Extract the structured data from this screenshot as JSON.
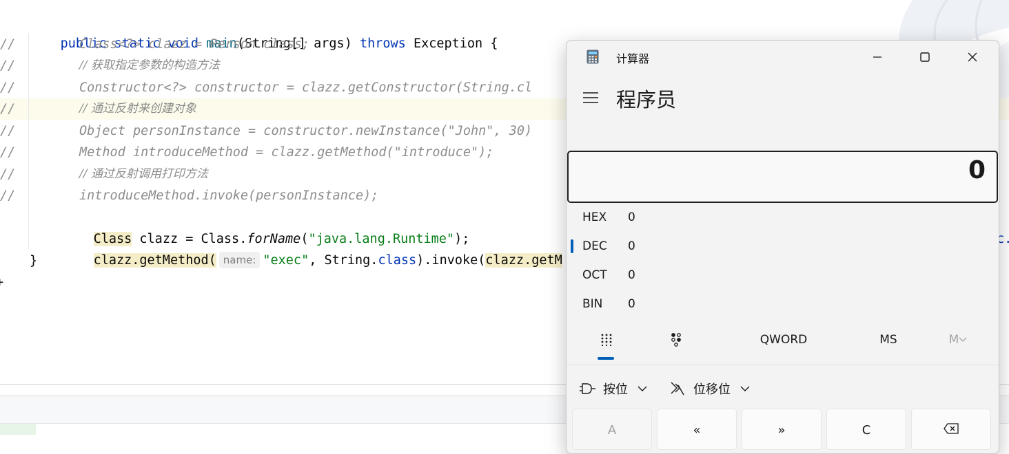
{
  "editor": {
    "lines": {
      "l1": {
        "kw_public": "public",
        "kw_static": "static",
        "kw_void": "void",
        "fn_main": "main",
        "sig": "(String[] args)",
        "kw_throws": "throws",
        "rest": "Exception {"
      },
      "l2": {
        "gutter": "//",
        "code": "Class<?> clazz = Person.class;"
      },
      "l3": {
        "gutter": "//",
        "code": "// 获取指定参数的构造方法"
      },
      "l4": {
        "gutter": "//",
        "code": "Constructor<?> constructor = clazz.getConstructor(String.cl"
      },
      "l5": {
        "gutter": "//",
        "code": "// 通过反射来创建对象"
      },
      "l6": {
        "gutter": "//",
        "code": "Object personInstance = constructor.newInstance(\"John\", 30)"
      },
      "l7": {
        "gutter": "//",
        "code": "Method introduceMethod = clazz.getMethod(\"introduce\");"
      },
      "l8": {
        "gutter": "//",
        "code": "// 通过反射调用打印方法"
      },
      "l9": {
        "gutter": "//",
        "code": "introduceMethod.invoke(personInstance);"
      },
      "l10": {
        "class_kw": "Class",
        "a": " clazz = Class.",
        "forname": "forName",
        "b": "(",
        "str": "\"java.lang.Runtime\"",
        "c": ");"
      },
      "l11": {
        "usage1": "clazz.getMethod(",
        "hint": "name:",
        "str": "\"exec\"",
        "a": ", String.",
        "kw_class": "class",
        "b": ").invoke(",
        "usage2": "clazz.getM",
        "tail": "c."
      },
      "l12": {
        "code": "}"
      },
      "l13": {
        "code": "+"
      }
    }
  },
  "calculator": {
    "window_title": "计算器",
    "mode": "程序员",
    "display_value": "0",
    "radix": [
      {
        "label": "HEX",
        "value": "0"
      },
      {
        "label": "DEC",
        "value": "0",
        "active": true
      },
      {
        "label": "OCT",
        "value": "0"
      },
      {
        "label": "BIN",
        "value": "0"
      }
    ],
    "toolbar": {
      "word_size": "QWORD",
      "memory_store": "MS",
      "memory_menu": "M"
    },
    "dropdowns": {
      "bitwise": "按位",
      "bitshift": "位移位"
    },
    "keys": {
      "a": "A",
      "lshift": "«",
      "rshift": "»",
      "clear": "C"
    }
  },
  "colors": {
    "accent": "#005fb8",
    "keyword": "#0033b3",
    "string": "#067d17",
    "comment": "#8c8c8c",
    "function": "#00627a"
  }
}
